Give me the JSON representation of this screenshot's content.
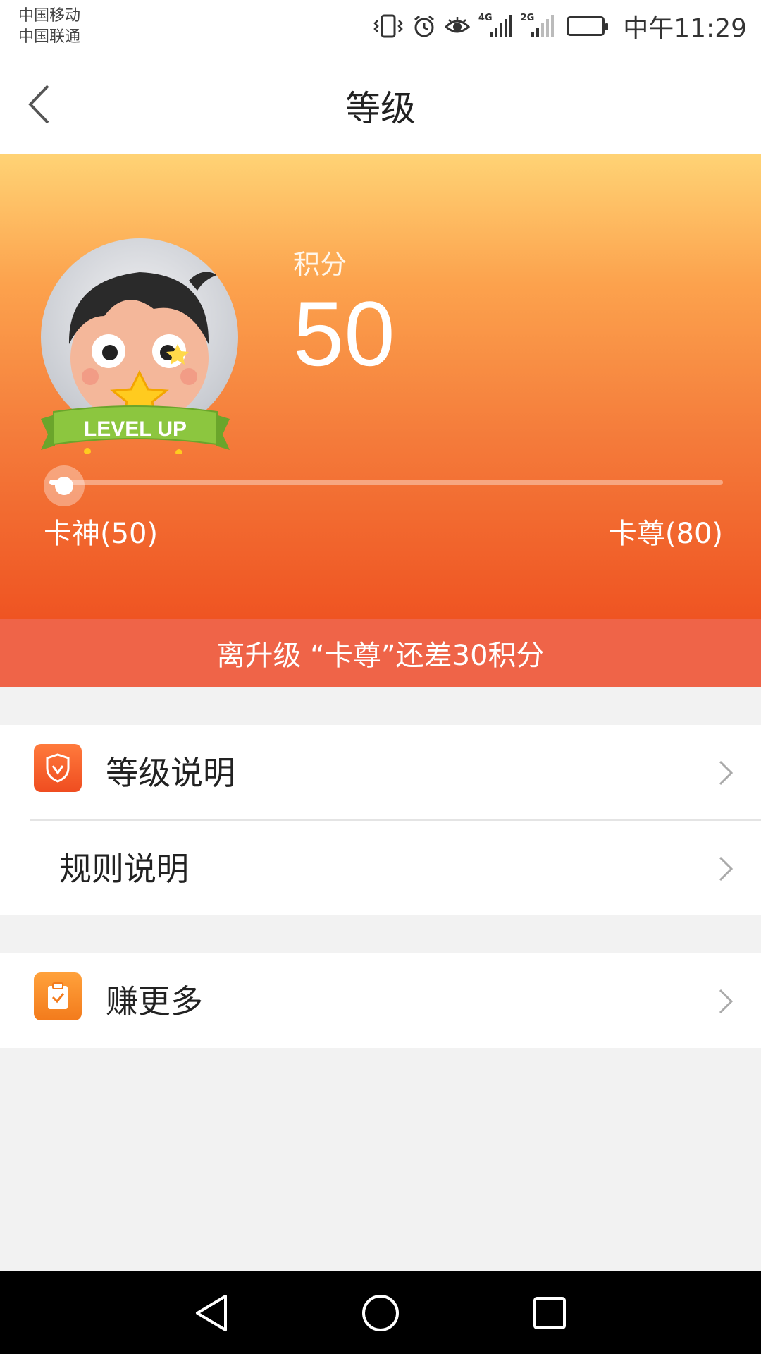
{
  "status_bar": {
    "carrier_1": "中国移动",
    "carrier_2": "中国联通",
    "net_1": "4G",
    "net_2": "2G",
    "time": "中午11:29",
    "icons": [
      "vibrate-icon",
      "alarm-icon",
      "eye-icon",
      "signal-4g-icon",
      "signal-2g-icon",
      "battery-icon"
    ]
  },
  "header": {
    "title": "等级",
    "back_icon": "chevron-left-icon"
  },
  "hero": {
    "score_label": "积分",
    "score_value": "50",
    "badge_text": "LEVEL UP",
    "progress_fraction": 0.02,
    "current_level": "卡神(50)",
    "next_level": "卡尊(80)",
    "gradient_colors": [
      "#ffd375",
      "#fca24d",
      "#f47a3a",
      "#ef5422"
    ]
  },
  "upgrade_banner": {
    "text": "离升级 “卡尊”还差30积分",
    "color": "#ef6448"
  },
  "list_group_1": {
    "items": [
      {
        "label": "等级说明",
        "icon": "shield-check-icon"
      },
      {
        "label": "规则说明"
      }
    ]
  },
  "list_group_2": {
    "items": [
      {
        "label": "赚更多",
        "icon": "clipboard-check-icon"
      }
    ]
  },
  "nav_bar": {
    "icons": [
      "nav-back-icon",
      "nav-home-icon",
      "nav-recents-icon"
    ]
  }
}
